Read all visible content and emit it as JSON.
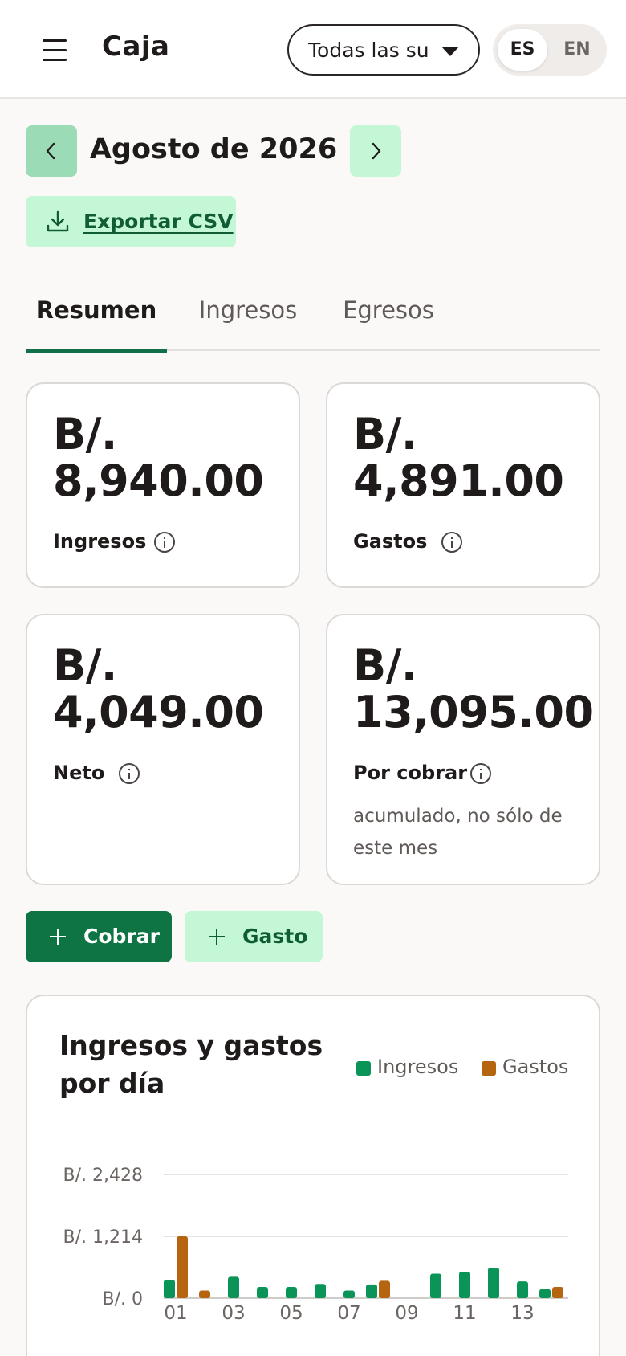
{
  "header": {
    "title": "Caja",
    "branch_select_value": "Todas las sucursales",
    "lang_options": [
      "ES",
      "EN"
    ],
    "lang_active": "ES"
  },
  "month_nav": {
    "label": "Agosto de 2026"
  },
  "export": {
    "label": "Exportar CSV"
  },
  "tabs": [
    {
      "label": "Resumen",
      "active": true
    },
    {
      "label": "Ingresos",
      "active": false
    },
    {
      "label": "Egresos",
      "active": false
    }
  ],
  "cards": [
    {
      "amount_line1": "B/.",
      "amount_line2": "8,940.00",
      "label": "Ingresos"
    },
    {
      "amount_line1": "B/.",
      "amount_line2": "4,891.00",
      "label": "Gastos"
    },
    {
      "amount_line1": "B/.",
      "amount_line2": "4,049.00",
      "label": "Neto"
    },
    {
      "amount_line1": "B/.",
      "amount_line2": "13,095.00",
      "label": "Por cobrar",
      "note": "acumulado, no sólo de este mes"
    }
  ],
  "actions": {
    "cobrar_label": "Cobrar",
    "gasto_label": "Gasto"
  },
  "colors": {
    "accent": "#10704a",
    "ingresos": "#0a9457",
    "gastos": "#b5640f",
    "button_light": "#c4f7d6"
  },
  "chart_data": {
    "type": "bar",
    "title": "Ingresos y gastos por día",
    "legend": [
      "Ingresos",
      "Gastos"
    ],
    "legend_position": "top-right",
    "y_tick_labels": [
      "B/. 2,428",
      "B/. 1,214",
      "B/. 0"
    ],
    "y_ticks": [
      2428,
      1214,
      0
    ],
    "ylim": [
      0,
      2428
    ],
    "x_tick_labels": [
      "01",
      "03",
      "05",
      "07",
      "09",
      "11",
      "13"
    ],
    "categories": [
      "01",
      "02",
      "03",
      "04",
      "05",
      "06",
      "07",
      "08",
      "09",
      "10",
      "11",
      "12",
      "13",
      "14"
    ],
    "series": [
      {
        "name": "Ingresos",
        "values": [
          360,
          0,
          420,
          220,
          220,
          280,
          150,
          270,
          0,
          480,
          520,
          600,
          330,
          180
        ]
      },
      {
        "name": "Gastos",
        "values": [
          1214,
          150,
          0,
          0,
          0,
          0,
          0,
          340,
          0,
          0,
          0,
          0,
          0,
          220
        ]
      }
    ],
    "grid": true
  }
}
